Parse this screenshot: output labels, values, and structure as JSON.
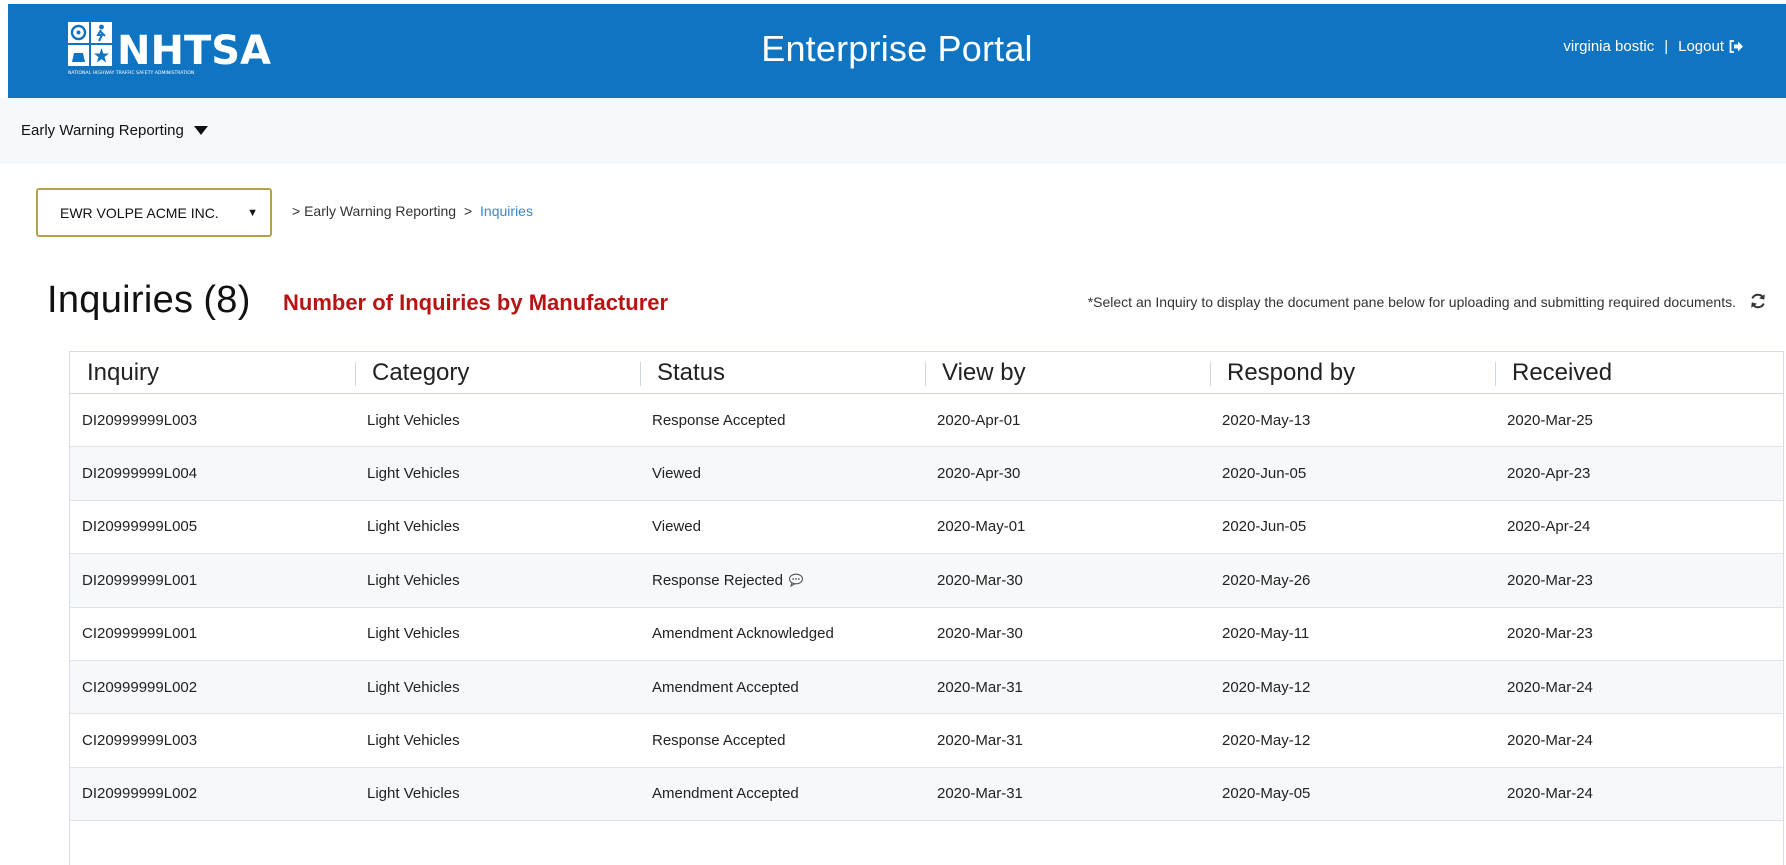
{
  "header": {
    "logo_text": "NHTSA",
    "logo_subtext": "NATIONAL HIGHWAY TRAFFIC SAFETY ADMINISTRATION",
    "title": "Enterprise Portal",
    "user_name": "virginia bostic",
    "separator": "|",
    "logout_label": "Logout",
    "bar_color": "#0f74c2"
  },
  "subnav": {
    "app_menu_label": "Early Warning Reporting"
  },
  "org_select": {
    "value": "EWR VOLPE ACME INC.",
    "border_color": "#b7a14a"
  },
  "breadcrumb": {
    "prefix": ">",
    "section": "Early Warning Reporting",
    "separator": ">",
    "current": "Inquiries"
  },
  "page": {
    "title": "Inquiries",
    "count": "(8)",
    "annotation": "Number of Inquiries by Manufacturer",
    "annotation_color": "#b81414",
    "hint": "*Select an Inquiry to display the document pane below for uploading and submitting required documents."
  },
  "table": {
    "columns": [
      "Inquiry",
      "Category",
      "Status",
      "View by",
      "Respond by",
      "Received"
    ],
    "rows": [
      {
        "inquiry": "DI20999999L003",
        "category": "Light Vehicles",
        "status": "Response Accepted",
        "view_by": "2020-Apr-01",
        "respond_by": "2020-May-13",
        "received": "2020-Mar-25"
      },
      {
        "inquiry": "DI20999999L004",
        "category": "Light Vehicles",
        "status": "Viewed",
        "view_by": "2020-Apr-30",
        "respond_by": "2020-Jun-05",
        "received": "2020-Apr-23"
      },
      {
        "inquiry": "DI20999999L005",
        "category": "Light Vehicles",
        "status": "Viewed",
        "view_by": "2020-May-01",
        "respond_by": "2020-Jun-05",
        "received": "2020-Apr-24"
      },
      {
        "inquiry": "DI20999999L001",
        "category": "Light Vehicles",
        "status": "Response Rejected",
        "view_by": "2020-Mar-30",
        "respond_by": "2020-May-26",
        "received": "2020-Mar-23"
      },
      {
        "inquiry": "CI20999999L001",
        "category": "Light Vehicles",
        "status": "Amendment Acknowledged",
        "view_by": "2020-Mar-30",
        "respond_by": "2020-May-11",
        "received": "2020-Mar-23"
      },
      {
        "inquiry": "CI20999999L002",
        "category": "Light Vehicles",
        "status": "Amendment Accepted",
        "view_by": "2020-Mar-31",
        "respond_by": "2020-May-12",
        "received": "2020-Mar-24"
      },
      {
        "inquiry": "CI20999999L003",
        "category": "Light Vehicles",
        "status": "Response Accepted",
        "view_by": "2020-Mar-31",
        "respond_by": "2020-May-12",
        "received": "2020-Mar-24"
      },
      {
        "inquiry": "DI20999999L002",
        "category": "Light Vehicles",
        "status": "Amendment Accepted",
        "view_by": "2020-Mar-31",
        "respond_by": "2020-May-05",
        "received": "2020-Mar-24"
      }
    ]
  }
}
